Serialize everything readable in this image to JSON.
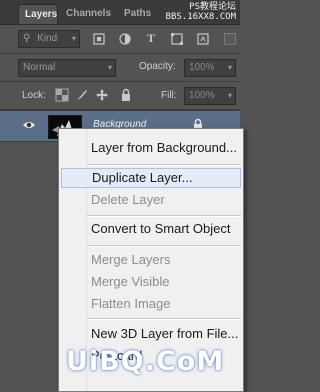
{
  "tabs": [
    {
      "label": "Layers"
    },
    {
      "label": "Channels"
    },
    {
      "label": "Paths"
    }
  ],
  "watermark_top": {
    "line1": "PS教程论坛",
    "line2": "BBS.16XX8.COM"
  },
  "filter": {
    "kind_label": "Kind"
  },
  "blend": {
    "mode": "Normal",
    "opacity_label": "Opacity:",
    "opacity_value": "100%"
  },
  "lock": {
    "label": "Lock:",
    "fill_label": "Fill:",
    "fill_value": "100%"
  },
  "layer": {
    "name": "Background"
  },
  "menu": {
    "items": [
      {
        "label": "Layer from Background...",
        "enabled": true
      },
      {
        "label": "Duplicate Layer...",
        "enabled": true,
        "highlighted": true
      },
      {
        "label": "Delete Layer",
        "enabled": false
      },
      {
        "label": "Convert to Smart Object",
        "enabled": true
      },
      {
        "label": "Merge Layers",
        "enabled": false
      },
      {
        "label": "Merge Visible",
        "enabled": false
      },
      {
        "label": "Flatten Image",
        "enabled": false
      },
      {
        "label": "New 3D Layer from File...",
        "enabled": true
      },
      {
        "label": "Postcard",
        "enabled": true
      }
    ]
  },
  "watermark_bottom": "UiBQ.CoM",
  "icons": [
    "filter-pixel-icon",
    "filter-adjustment-icon",
    "filter-type-icon",
    "filter-shape-icon",
    "filter-smart-object-icon",
    "lock-transparent-icon",
    "lock-brush-icon",
    "lock-move-icon",
    "lock-all-icon",
    "eye-icon",
    "lock-icon"
  ],
  "colors": {
    "panel_bg": "#535353",
    "selected_layer": "#5b6e88",
    "menu_bg": "#f0f0f0",
    "menu_highlight": "#e3ecf7"
  }
}
